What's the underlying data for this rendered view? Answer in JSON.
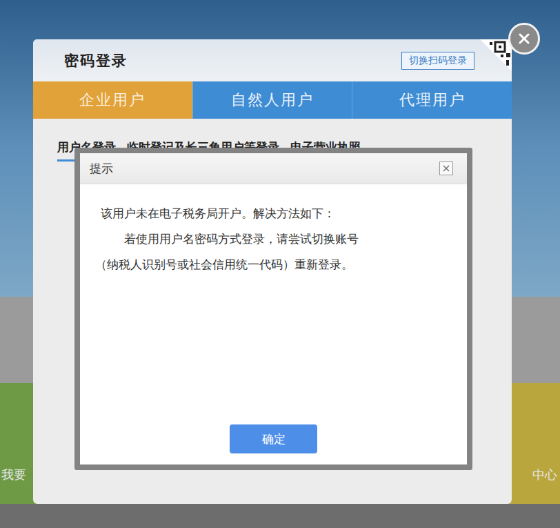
{
  "login": {
    "title": "密码登录",
    "switch_button": "切换扫码登录"
  },
  "tabs": [
    {
      "label": "企业用户",
      "selected": true
    },
    {
      "label": "自然人用户",
      "selected": false
    },
    {
      "label": "代理用户",
      "selected": false
    }
  ],
  "login_methods": [
    {
      "label": "用户名登录",
      "selected": true
    },
    {
      "label": "临时登记及长三角用户等登录",
      "selected": false
    },
    {
      "label": "电子营业执照",
      "selected": false
    }
  ],
  "background_tiles": [
    {
      "label": "我要",
      "color": "#6f9a45"
    },
    {
      "label": "中心",
      "color": "#b9a63c"
    }
  ],
  "dialog": {
    "title": "提示",
    "message": [
      "该用户未在电子税务局开户。解决方法如下：",
      "若使用用户名密码方式登录，请尝试切换账号",
      "（纳税人识别号或社会信用统一代码）重新登录。"
    ],
    "button": "确定"
  }
}
